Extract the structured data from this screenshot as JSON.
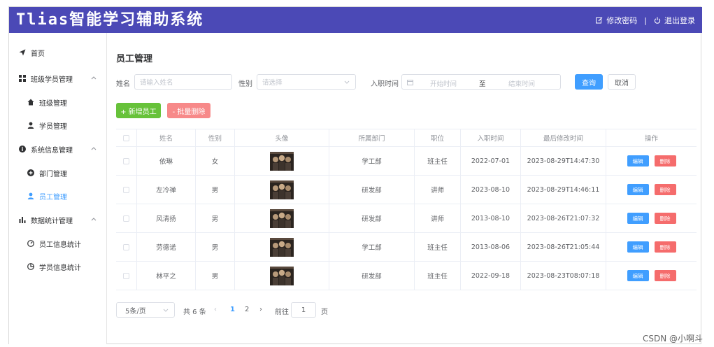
{
  "header": {
    "title": "Tlias智能学习辅助系统",
    "change_password": "修改密码",
    "separator": "|",
    "logout": "退出登录"
  },
  "sidebar": {
    "items": [
      {
        "label": "首页",
        "icon": "paper-plane-icon"
      },
      {
        "label": "班级学员管理",
        "icon": "grid-icon"
      },
      {
        "label": "班级管理",
        "icon": "home-icon"
      },
      {
        "label": "学员管理",
        "icon": "user-icon"
      },
      {
        "label": "系统信息管理",
        "icon": "info-icon"
      },
      {
        "label": "部门管理",
        "icon": "plus-circle-icon"
      },
      {
        "label": "员工管理",
        "icon": "user-icon"
      },
      {
        "label": "数据统计管理",
        "icon": "bar-chart-icon"
      },
      {
        "label": "员工信息统计",
        "icon": "gauge-icon"
      },
      {
        "label": "学员信息统计",
        "icon": "pie-icon"
      }
    ],
    "active_color": "#409eff"
  },
  "page": {
    "title": "员工管理"
  },
  "filters": {
    "name_label": "姓名",
    "name_placeholder": "请输入姓名",
    "gender_label": "性别",
    "gender_placeholder": "请选择",
    "date_label": "入职时间",
    "start_placeholder": "开始时间",
    "range_sep": "至",
    "end_placeholder": "结束时间",
    "query": "查询",
    "cancel": "取消"
  },
  "actions": {
    "add": "+ 新增员工",
    "batch_delete": "- 批量删除"
  },
  "table": {
    "columns": [
      "姓名",
      "性别",
      "头像",
      "所属部门",
      "职位",
      "入职时间",
      "最后修改时间",
      "操作"
    ],
    "rows": [
      {
        "name": "依琳",
        "gender": "女",
        "dept": "学工部",
        "job": "班主任",
        "entry": "2022-07-01",
        "updated": "2023-08-29T14:47:30"
      },
      {
        "name": "左冷禅",
        "gender": "男",
        "dept": "研发部",
        "job": "讲师",
        "entry": "2023-08-10",
        "updated": "2023-08-29T14:46:11"
      },
      {
        "name": "风清扬",
        "gender": "男",
        "dept": "研发部",
        "job": "讲师",
        "entry": "2013-08-10",
        "updated": "2023-08-26T21:07:32"
      },
      {
        "name": "劳德诺",
        "gender": "男",
        "dept": "学工部",
        "job": "班主任",
        "entry": "2013-08-06",
        "updated": "2023-08-26T21:05:44"
      },
      {
        "name": "林平之",
        "gender": "男",
        "dept": "研发部",
        "job": "班主任",
        "entry": "2022-09-18",
        "updated": "2023-08-23T08:07:18"
      }
    ],
    "edit": "编辑",
    "delete": "删除"
  },
  "pager": {
    "page_size": "5条/页",
    "total": "共 6 条",
    "prev": "‹",
    "pages": [
      "1",
      "2"
    ],
    "next": "›",
    "goto": "前往",
    "goto_value": "1",
    "page_unit": "页"
  },
  "watermark": "CSDN @小啊斗"
}
